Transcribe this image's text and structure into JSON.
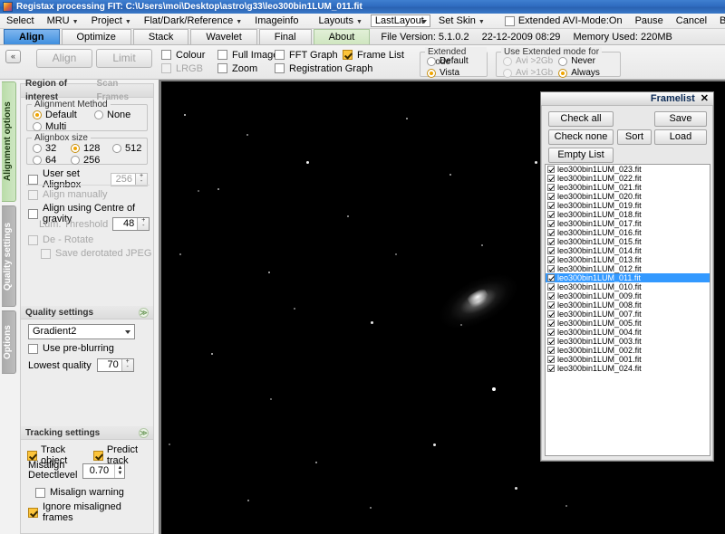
{
  "window": {
    "title": "Registax processing FIT: C:\\Users\\moi\\Desktop\\astro\\g33\\leo300bin1LUM_011.fit",
    "icon": "registax-icon"
  },
  "menubar": {
    "items": [
      {
        "label": "Select",
        "caret": false
      },
      {
        "label": "MRU",
        "caret": true
      },
      {
        "label": "Project",
        "caret": true
      },
      {
        "label": "Flat/Dark/Reference",
        "caret": true
      },
      {
        "label": "Imageinfo",
        "caret": false
      },
      {
        "label": "Layouts",
        "caret": true
      }
    ],
    "layout_value": "LastLayout",
    "set_skin": "Set Skin",
    "extended_avi_mode": {
      "label": "Extended AVI-Mode:On",
      "checked": false
    },
    "actions": [
      "Pause",
      "Cancel",
      "Batch"
    ]
  },
  "tabs": [
    {
      "label": "Align",
      "state": "active"
    },
    {
      "label": "Optimize",
      "state": "normal"
    },
    {
      "label": "Stack",
      "state": "normal"
    },
    {
      "label": "Wavelet",
      "state": "normal"
    },
    {
      "label": "Final",
      "state": "normal"
    },
    {
      "label": "About",
      "state": "about"
    }
  ],
  "status": {
    "file_version": "File Version: 5.1.0.2",
    "datetime": "22-12-2009 08:29",
    "memory": "Memory Used: 220MB"
  },
  "toolbar": {
    "collapse_label": "«",
    "align_button": "Align",
    "limit_button": "Limit",
    "checks": [
      {
        "label": "Colour",
        "checked": false,
        "disabled": false
      },
      {
        "label": "LRGB",
        "checked": false,
        "disabled": true
      },
      {
        "label": "Full Image",
        "checked": false,
        "disabled": false
      },
      {
        "label": "Zoom",
        "checked": false,
        "disabled": false
      },
      {
        "label": "FFT Graph",
        "checked": false,
        "disabled": false
      },
      {
        "label": "Registration Graph",
        "checked": false,
        "disabled": false
      },
      {
        "label": "Frame List",
        "checked": true,
        "disabled": false
      }
    ],
    "extended_mode": {
      "legend": "Extended Mode",
      "options": [
        {
          "label": "Default",
          "selected": false
        },
        {
          "label": "Vista",
          "selected": true
        }
      ]
    },
    "use_extended_for": {
      "legend": "Use  Extended mode for",
      "options": [
        {
          "label": "Avi >2Gb",
          "selected": false
        },
        {
          "label": "Never",
          "selected": false
        },
        {
          "label": "Avi >1Gb",
          "selected": false
        },
        {
          "label": "Always",
          "selected": true
        }
      ]
    }
  },
  "vtabs": [
    {
      "label": "Alignment options",
      "active": true
    },
    {
      "label": "Quality settings",
      "active": false
    },
    {
      "label": "Options",
      "active": false
    }
  ],
  "left_panel": {
    "roi": {
      "title": "Region of interest",
      "scan_frames": "Scan Frames"
    },
    "alignment_method": {
      "legend": "Alignment Method",
      "options": [
        {
          "label": "Default",
          "selected": true
        },
        {
          "label": "None",
          "selected": false
        },
        {
          "label": "Multi",
          "selected": false
        }
      ]
    },
    "alignbox_size": {
      "legend": "Alignbox size",
      "options": [
        {
          "label": "32",
          "selected": false
        },
        {
          "label": "128",
          "selected": true
        },
        {
          "label": "512",
          "selected": false
        },
        {
          "label": "64",
          "selected": false
        },
        {
          "label": "256",
          "selected": false
        }
      ]
    },
    "user_set_alignbox": {
      "label": "User set Alignbox",
      "checked": false,
      "value": "256"
    },
    "align_manually": {
      "label": "Align manually",
      "checked": false
    },
    "align_cog": {
      "label": "Align using Centre of gravity",
      "checked": false
    },
    "lum_threshold": {
      "label": "Lum. Threshold",
      "value": "48"
    },
    "de_rotate": {
      "label": "De - Rotate",
      "checked": false
    },
    "save_derotated": {
      "label": "Save derotated JPEG",
      "checked": false
    },
    "quality_settings": {
      "title": "Quality settings",
      "method": "Gradient2",
      "use_preblurring": {
        "label": "Use pre-blurring",
        "checked": false
      },
      "lowest_quality": {
        "label": "Lowest quality",
        "value": "70"
      }
    },
    "tracking_settings": {
      "title": "Tracking settings",
      "track_object": {
        "label": "Track object",
        "checked": true
      },
      "predict_track": {
        "label": "Predict track",
        "checked": true
      },
      "misalign_detectlevel": {
        "label1": "Misalign",
        "label2": "Detectlevel",
        "value": "0.70"
      },
      "misalign_warning": {
        "label": "Misalign warning",
        "checked": false
      },
      "ignore_misaligned": {
        "label": "Ignore misaligned frames",
        "checked": true
      }
    }
  },
  "framelist": {
    "title": "Framelist",
    "close_icon": "✕",
    "buttons": [
      {
        "label": "Check all"
      },
      {
        "label": "Save"
      },
      {
        "label": "Check none"
      },
      {
        "label": "Sort"
      },
      {
        "label": "Load"
      },
      {
        "label": "Empty List"
      }
    ],
    "files": [
      {
        "name": "leo300bin1LUM_023.fit",
        "checked": true,
        "selected": false
      },
      {
        "name": "leo300bin1LUM_022.fit",
        "checked": true,
        "selected": false
      },
      {
        "name": "leo300bin1LUM_021.fit",
        "checked": true,
        "selected": false
      },
      {
        "name": "leo300bin1LUM_020.fit",
        "checked": true,
        "selected": false
      },
      {
        "name": "leo300bin1LUM_019.fit",
        "checked": true,
        "selected": false
      },
      {
        "name": "leo300bin1LUM_018.fit",
        "checked": true,
        "selected": false
      },
      {
        "name": "leo300bin1LUM_017.fit",
        "checked": true,
        "selected": false
      },
      {
        "name": "leo300bin1LUM_016.fit",
        "checked": true,
        "selected": false
      },
      {
        "name": "leo300bin1LUM_015.fit",
        "checked": true,
        "selected": false
      },
      {
        "name": "leo300bin1LUM_014.fit",
        "checked": true,
        "selected": false
      },
      {
        "name": "leo300bin1LUM_013.fit",
        "checked": true,
        "selected": false
      },
      {
        "name": "leo300bin1LUM_012.fit",
        "checked": true,
        "selected": false
      },
      {
        "name": "leo300bin1LUM_011.fit",
        "checked": true,
        "selected": true
      },
      {
        "name": "leo300bin1LUM_010.fit",
        "checked": true,
        "selected": false
      },
      {
        "name": "leo300bin1LUM_009.fit",
        "checked": true,
        "selected": false
      },
      {
        "name": "leo300bin1LUM_008.fit",
        "checked": true,
        "selected": false
      },
      {
        "name": "leo300bin1LUM_007.fit",
        "checked": true,
        "selected": false
      },
      {
        "name": "leo300bin1LUM_005.fit",
        "checked": true,
        "selected": false
      },
      {
        "name": "leo300bin1LUM_004.fit",
        "checked": true,
        "selected": false
      },
      {
        "name": "leo300bin1LUM_003.fit",
        "checked": true,
        "selected": false
      },
      {
        "name": "leo300bin1LUM_002.fit",
        "checked": true,
        "selected": false
      },
      {
        "name": "leo300bin1LUM_001.fit",
        "checked": true,
        "selected": false
      },
      {
        "name": "leo300bin1LUM_024.fit",
        "checked": true,
        "selected": false
      }
    ]
  },
  "image_view": {
    "description": "astronomical-image-galaxy-field",
    "background": "#000000"
  },
  "colors": {
    "title_bar": "#2f6cc0",
    "active_tab": "#3f8fdf",
    "selection": "#3399ff",
    "check_accent": "#fcc43a",
    "radio_accent": "#f0a500",
    "vtab_active": "#b9dca8"
  }
}
